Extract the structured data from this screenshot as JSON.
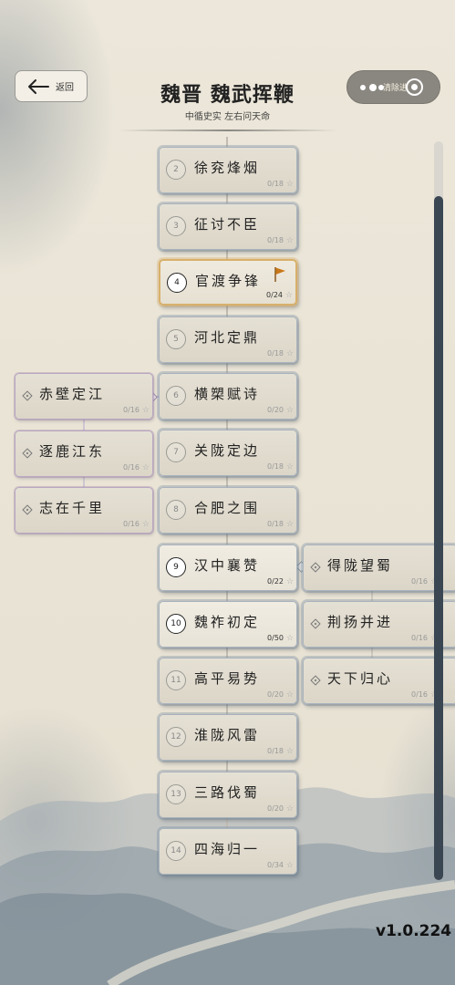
{
  "header": {
    "back_label": "返回",
    "title": "魏晋 魏武挥鞭",
    "subtitle": "中循史实  左右问天命",
    "clear_progress_label": "清除进"
  },
  "icons": {
    "back": "arrow-left-icon",
    "flag": "flag-icon",
    "star": "star-icon",
    "menu": "more-dots-icon",
    "close": "target-circle-icon"
  },
  "colors": {
    "active_border": "#d8b06b",
    "flag": "#c8781a",
    "branch_left": "#b9a7c2",
    "scroll_thumb": "#3a4652"
  },
  "main_levels": [
    {
      "num": "2",
      "name": "徐兖烽烟",
      "progress": "0/18",
      "state": "locked"
    },
    {
      "num": "3",
      "name": "征讨不臣",
      "progress": "0/18",
      "state": "locked"
    },
    {
      "num": "4",
      "name": "官渡争锋",
      "progress": "0/24",
      "state": "current"
    },
    {
      "num": "5",
      "name": "河北定鼎",
      "progress": "0/18",
      "state": "locked"
    },
    {
      "num": "6",
      "name": "横槊赋诗",
      "progress": "0/20",
      "state": "locked"
    },
    {
      "num": "7",
      "name": "关陇定边",
      "progress": "0/18",
      "state": "locked"
    },
    {
      "num": "8",
      "name": "合肥之围",
      "progress": "0/18",
      "state": "locked"
    },
    {
      "num": "9",
      "name": "汉中襄赞",
      "progress": "0/22",
      "state": "cleared"
    },
    {
      "num": "10",
      "name": "魏祚初定",
      "progress": "0/50",
      "state": "cleared"
    },
    {
      "num": "11",
      "name": "高平易势",
      "progress": "0/20",
      "state": "locked"
    },
    {
      "num": "12",
      "name": "淮陇风雷",
      "progress": "0/18",
      "state": "locked"
    },
    {
      "num": "13",
      "name": "三路伐蜀",
      "progress": "0/20",
      "state": "locked"
    },
    {
      "num": "14",
      "name": "四海归一",
      "progress": "0/34",
      "state": "locked"
    }
  ],
  "left_branch": [
    {
      "name": "赤壁定江",
      "progress": "0/16"
    },
    {
      "name": "逐鹿江东",
      "progress": "0/16"
    },
    {
      "name": "志在千里",
      "progress": "0/16"
    }
  ],
  "right_branch": [
    {
      "name": "得陇望蜀",
      "progress": "0/16"
    },
    {
      "name": "荆扬并进",
      "progress": "0/16"
    },
    {
      "name": "天下归心",
      "progress": "0/16"
    }
  ],
  "version": "v1.0.224"
}
